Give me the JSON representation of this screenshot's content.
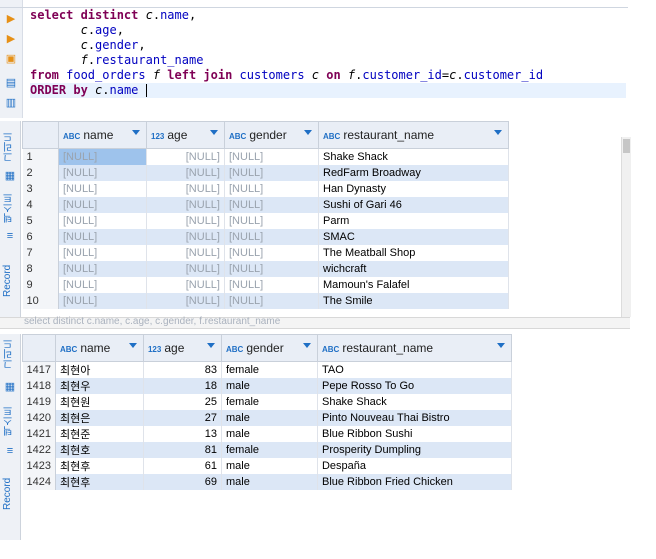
{
  "editor": {
    "lines": [
      {
        "parts": [
          [
            "kw",
            "select distinct "
          ],
          [
            "al",
            "c"
          ],
          [
            "op",
            "."
          ],
          [
            "id",
            "name"
          ],
          [
            "op",
            ","
          ]
        ]
      },
      {
        "parts": [
          [
            "op",
            "       "
          ],
          [
            "al",
            "c"
          ],
          [
            "op",
            "."
          ],
          [
            "id",
            "age"
          ],
          [
            "op",
            ","
          ]
        ]
      },
      {
        "parts": [
          [
            "op",
            "       "
          ],
          [
            "al",
            "c"
          ],
          [
            "op",
            "."
          ],
          [
            "id",
            "gender"
          ],
          [
            "op",
            ","
          ]
        ]
      },
      {
        "parts": [
          [
            "op",
            "       "
          ],
          [
            "al",
            "f"
          ],
          [
            "op",
            "."
          ],
          [
            "id",
            "restaurant_name"
          ]
        ]
      },
      {
        "parts": [
          [
            "kw",
            "from "
          ],
          [
            "id",
            "food_orders "
          ],
          [
            "al",
            "f "
          ],
          [
            "kw",
            "left join "
          ],
          [
            "id",
            "customers "
          ],
          [
            "al",
            "c "
          ],
          [
            "kw",
            "on "
          ],
          [
            "al",
            "f"
          ],
          [
            "op",
            "."
          ],
          [
            "id",
            "customer_id"
          ],
          [
            "op",
            "="
          ],
          [
            "al",
            "c"
          ],
          [
            "op",
            "."
          ],
          [
            "id",
            "customer_id"
          ]
        ]
      },
      {
        "parts": [
          [
            "kw",
            "ORDER by "
          ],
          [
            "al",
            "c"
          ],
          [
            "op",
            "."
          ],
          [
            "id",
            "name "
          ]
        ]
      }
    ]
  },
  "grid1": {
    "headers": [
      {
        "type": "ABC",
        "label": "name"
      },
      {
        "type": "123",
        "label": "age"
      },
      {
        "type": "ABC",
        "label": "gender"
      },
      {
        "type": "ABC",
        "label": "restaurant_name"
      }
    ],
    "rows": [
      {
        "n": "1",
        "name": "[NULL]",
        "age": "[NULL]",
        "gender": "[NULL]",
        "rest": "Shake Shack"
      },
      {
        "n": "2",
        "name": "[NULL]",
        "age": "[NULL]",
        "gender": "[NULL]",
        "rest": "RedFarm Broadway"
      },
      {
        "n": "3",
        "name": "[NULL]",
        "age": "[NULL]",
        "gender": "[NULL]",
        "rest": "Han Dynasty"
      },
      {
        "n": "4",
        "name": "[NULL]",
        "age": "[NULL]",
        "gender": "[NULL]",
        "rest": "Sushi of Gari 46"
      },
      {
        "n": "5",
        "name": "[NULL]",
        "age": "[NULL]",
        "gender": "[NULL]",
        "rest": "Parm"
      },
      {
        "n": "6",
        "name": "[NULL]",
        "age": "[NULL]",
        "gender": "[NULL]",
        "rest": "SMAC"
      },
      {
        "n": "7",
        "name": "[NULL]",
        "age": "[NULL]",
        "gender": "[NULL]",
        "rest": "The Meatball Shop"
      },
      {
        "n": "8",
        "name": "[NULL]",
        "age": "[NULL]",
        "gender": "[NULL]",
        "rest": "wichcraft"
      },
      {
        "n": "9",
        "name": "[NULL]",
        "age": "[NULL]",
        "gender": "[NULL]",
        "rest": "Mamoun's Falafel"
      },
      {
        "n": "10",
        "name": "[NULL]",
        "age": "[NULL]",
        "gender": "[NULL]",
        "rest": "The Smile"
      }
    ],
    "side_tabs": [
      "그리드",
      "텍스트",
      "Record"
    ]
  },
  "grid2": {
    "headers": [
      {
        "type": "ABC",
        "label": "name"
      },
      {
        "type": "123",
        "label": "age"
      },
      {
        "type": "ABC",
        "label": "gender"
      },
      {
        "type": "ABC",
        "label": "restaurant_name"
      }
    ],
    "rows": [
      {
        "n": "1417",
        "name": "최현아",
        "age": "83",
        "gender": "female",
        "rest": "TAO"
      },
      {
        "n": "1418",
        "name": "최현우",
        "age": "18",
        "gender": "male",
        "rest": "Pepe Rosso To Go"
      },
      {
        "n": "1419",
        "name": "최현원",
        "age": "25",
        "gender": "female",
        "rest": "Shake Shack"
      },
      {
        "n": "1420",
        "name": "최현은",
        "age": "27",
        "gender": "male",
        "rest": "Pinto Nouveau Thai Bistro"
      },
      {
        "n": "1421",
        "name": "최현준",
        "age": "13",
        "gender": "male",
        "rest": "Blue Ribbon Sushi"
      },
      {
        "n": "1422",
        "name": "최현호",
        "age": "81",
        "gender": "female",
        "rest": "Prosperity Dumpling"
      },
      {
        "n": "1423",
        "name": "최현후",
        "age": "61",
        "gender": "male",
        "rest": "Despaña"
      },
      {
        "n": "1424",
        "name": "최현후",
        "age": "69",
        "gender": "male",
        "rest": "Blue Ribbon Fried Chicken"
      }
    ],
    "side_tabs": [
      "그리드",
      "텍스트",
      "Record"
    ]
  },
  "divider_text": "select distinct c.name, c.age, c.gender, f.restaurant_name",
  "colors": {
    "keyword": "#7f0055",
    "identifier": "#0000c0",
    "row_alt": "#dce7f6",
    "selected": "#9ec3ec",
    "accent": "#1f6fc5"
  }
}
